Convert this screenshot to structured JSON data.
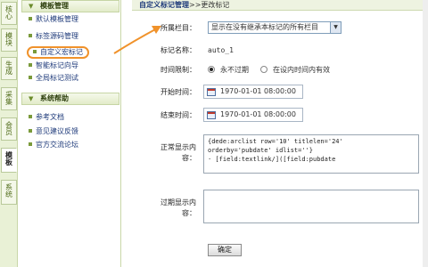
{
  "vtabs": [
    {
      "label": "核心"
    },
    {
      "label": "模块"
    },
    {
      "label": "生成"
    },
    {
      "label": "采集"
    },
    {
      "label": "会员"
    },
    {
      "label": "模板"
    },
    {
      "label": "系统"
    }
  ],
  "menu": {
    "section1_title": "模板管理",
    "section1_items": [
      "默认模板管理",
      "标签源码管理",
      "自定义宏标记",
      "智能标记向导",
      "全局标记测试"
    ],
    "section2_title": "系统帮助",
    "section2_items": [
      "参考文档",
      "意见建议反馈",
      "官方交流论坛"
    ]
  },
  "breadcrumb": {
    "current": "自定义标记管理",
    "sep": ">>",
    "action": "更改标记"
  },
  "form": {
    "column_label": "所属栏目：",
    "column_value": "显示在没有继承本标记的所有栏目",
    "tagname_label": "标记名称：",
    "tagname_value": "auto_1",
    "timelimit_label": "时间限制：",
    "timelimit_opt1": "永不过期",
    "timelimit_opt2": "在设内时间内有效",
    "start_label": "开始时间：",
    "start_value": "1970-01-01 08:00:00",
    "end_label": "结束时间：",
    "end_value": "1970-01-01 08:00:00",
    "normal_label_1": "正常显示内",
    "normal_label_2": "容：",
    "normal_content": "{dede:arclist row='10' titlelen='24'\norderby='pubdate' idlist=''}\n· [field:textlink/]([field:pubdate",
    "expired_label_1": "过期显示内",
    "expired_label_2": "容：",
    "expired_content": "",
    "submit_label": "确定"
  },
  "colors": {
    "accent": "#f0922b",
    "tab_bg": "#e9f1d6",
    "link": "#1e3a7a"
  }
}
